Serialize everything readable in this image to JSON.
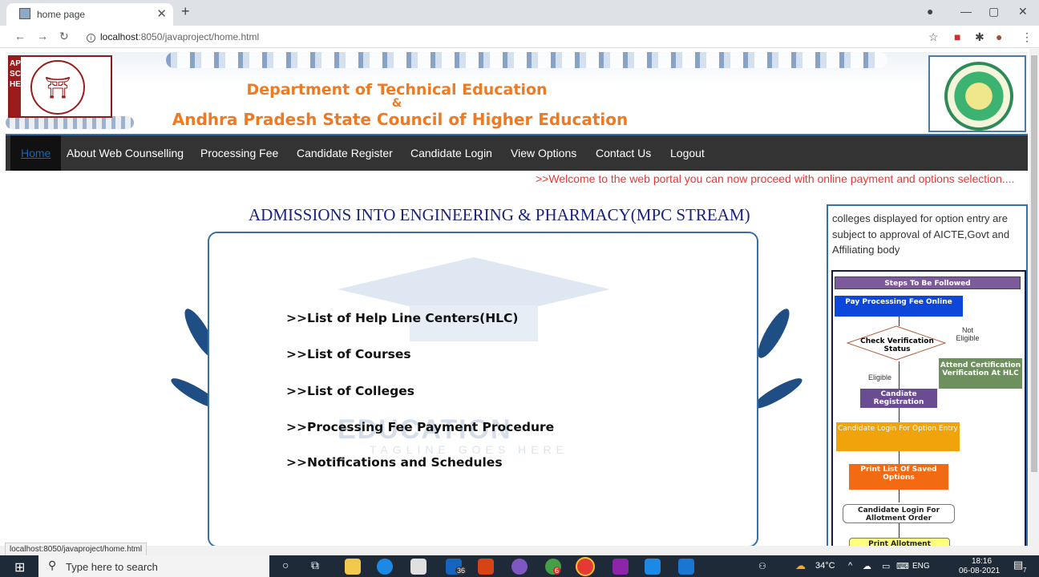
{
  "browser": {
    "tab_title": "home page",
    "url_host": "localhost",
    "url_rest": ":8050/javaproject/home.html",
    "status_url": "localhost:8050/javaproject/home.html"
  },
  "banner": {
    "logo_letters": "APSCHE",
    "title_line1": "Department of Technical Education",
    "title_amp": "&",
    "title_line2": "Andhra Pradesh State Council of Higher Education"
  },
  "menu": {
    "items": [
      {
        "label": "Home",
        "active": true
      },
      {
        "label": "About Web Counselling"
      },
      {
        "label": "Processing Fee"
      },
      {
        "label": "Candidate Register"
      },
      {
        "label": "Candidate Login"
      },
      {
        "label": "View Options"
      },
      {
        "label": "Contact Us"
      },
      {
        "label": "Logout"
      }
    ]
  },
  "marquee": ">>Welcome to the web portal you can now proceed with online payment and options selection....",
  "main": {
    "heading": "ADMISSIONS INTO ENGINEERING & PHARMACY(MPC STREAM)",
    "watermark_text": "EDUCATION",
    "watermark_tagline": "TAGLINE GOES HERE",
    "links": [
      ">>List of Help Line Centers(HLC)",
      ">>List of Courses",
      ">>List of Colleges",
      ">>Processing Fee Payment Procedure",
      ">>Notifications and Schedules"
    ]
  },
  "sidebar": {
    "note": "colleges displayed for option entry are subject to approval of AICTE,Govt and Affiliating body",
    "flow": {
      "title": "Steps To Be Followed",
      "pay": "Pay Processing Fee Online",
      "check": "Check Verification Status",
      "not_eligible": "Not Eligible",
      "attend": "Attend Certification Verification At HLC",
      "eligible": "Eligible",
      "register": "Candiate Registration",
      "login_option": "Candidate Login For Option Entry",
      "print_list": "Print List Of Saved Options",
      "login_allot": "Candidate Login For Allotment Order",
      "print_allot": "Print Allotment"
    }
  },
  "taskbar": {
    "search_placeholder": "Type here to search",
    "badge_mail": "36",
    "badge_chat": "6",
    "temperature": "34°C",
    "lang": "ENG",
    "time": "18:16",
    "date": "06-08-2021",
    "notif": "7"
  }
}
